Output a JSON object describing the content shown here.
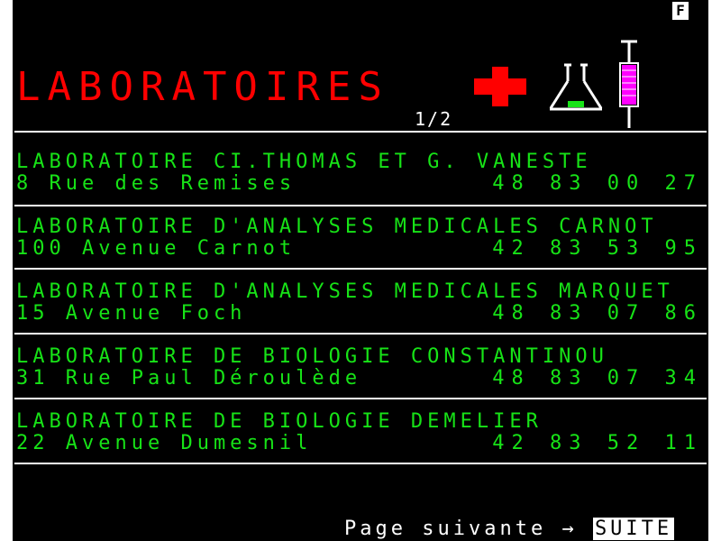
{
  "badge": "F",
  "title": "LABORATOIRES",
  "pager": "1/2",
  "entries": [
    {
      "name": "LABORATOIRE CI.THOMAS ET G. VANESTE",
      "address": "8 Rue des Remises",
      "phone": "48 83 00 27"
    },
    {
      "name": "LABORATOIRE D'ANALYSES MEDICALES CARNOT",
      "address": "100 Avenue Carnot",
      "phone": "42 83 53 95"
    },
    {
      "name": "LABORATOIRE D'ANALYSES MEDICALES MARQUET",
      "address": "15 Avenue Foch",
      "phone": "48 83 07 86"
    },
    {
      "name": "LABORATOIRE DE BIOLOGIE CONSTANTINOU",
      "address": "31 Rue Paul Déroulède",
      "phone": "48 83 07 34"
    },
    {
      "name": "LABORATOIRE DE BIOLOGIE DEMELIER",
      "address": "22 Avenue Dumesnil",
      "phone": "42 83 52 11"
    }
  ],
  "footer": {
    "label": "Page suivante",
    "arrow": "→",
    "key": "SUITE"
  },
  "icons": {
    "cross": "red-cross-icon",
    "flask": "flask-icon",
    "syringe": "syringe-icon"
  },
  "colors": {
    "title": "#ff0000",
    "text": "#17e317",
    "background": "#000000",
    "accent": "#ff00ff"
  }
}
